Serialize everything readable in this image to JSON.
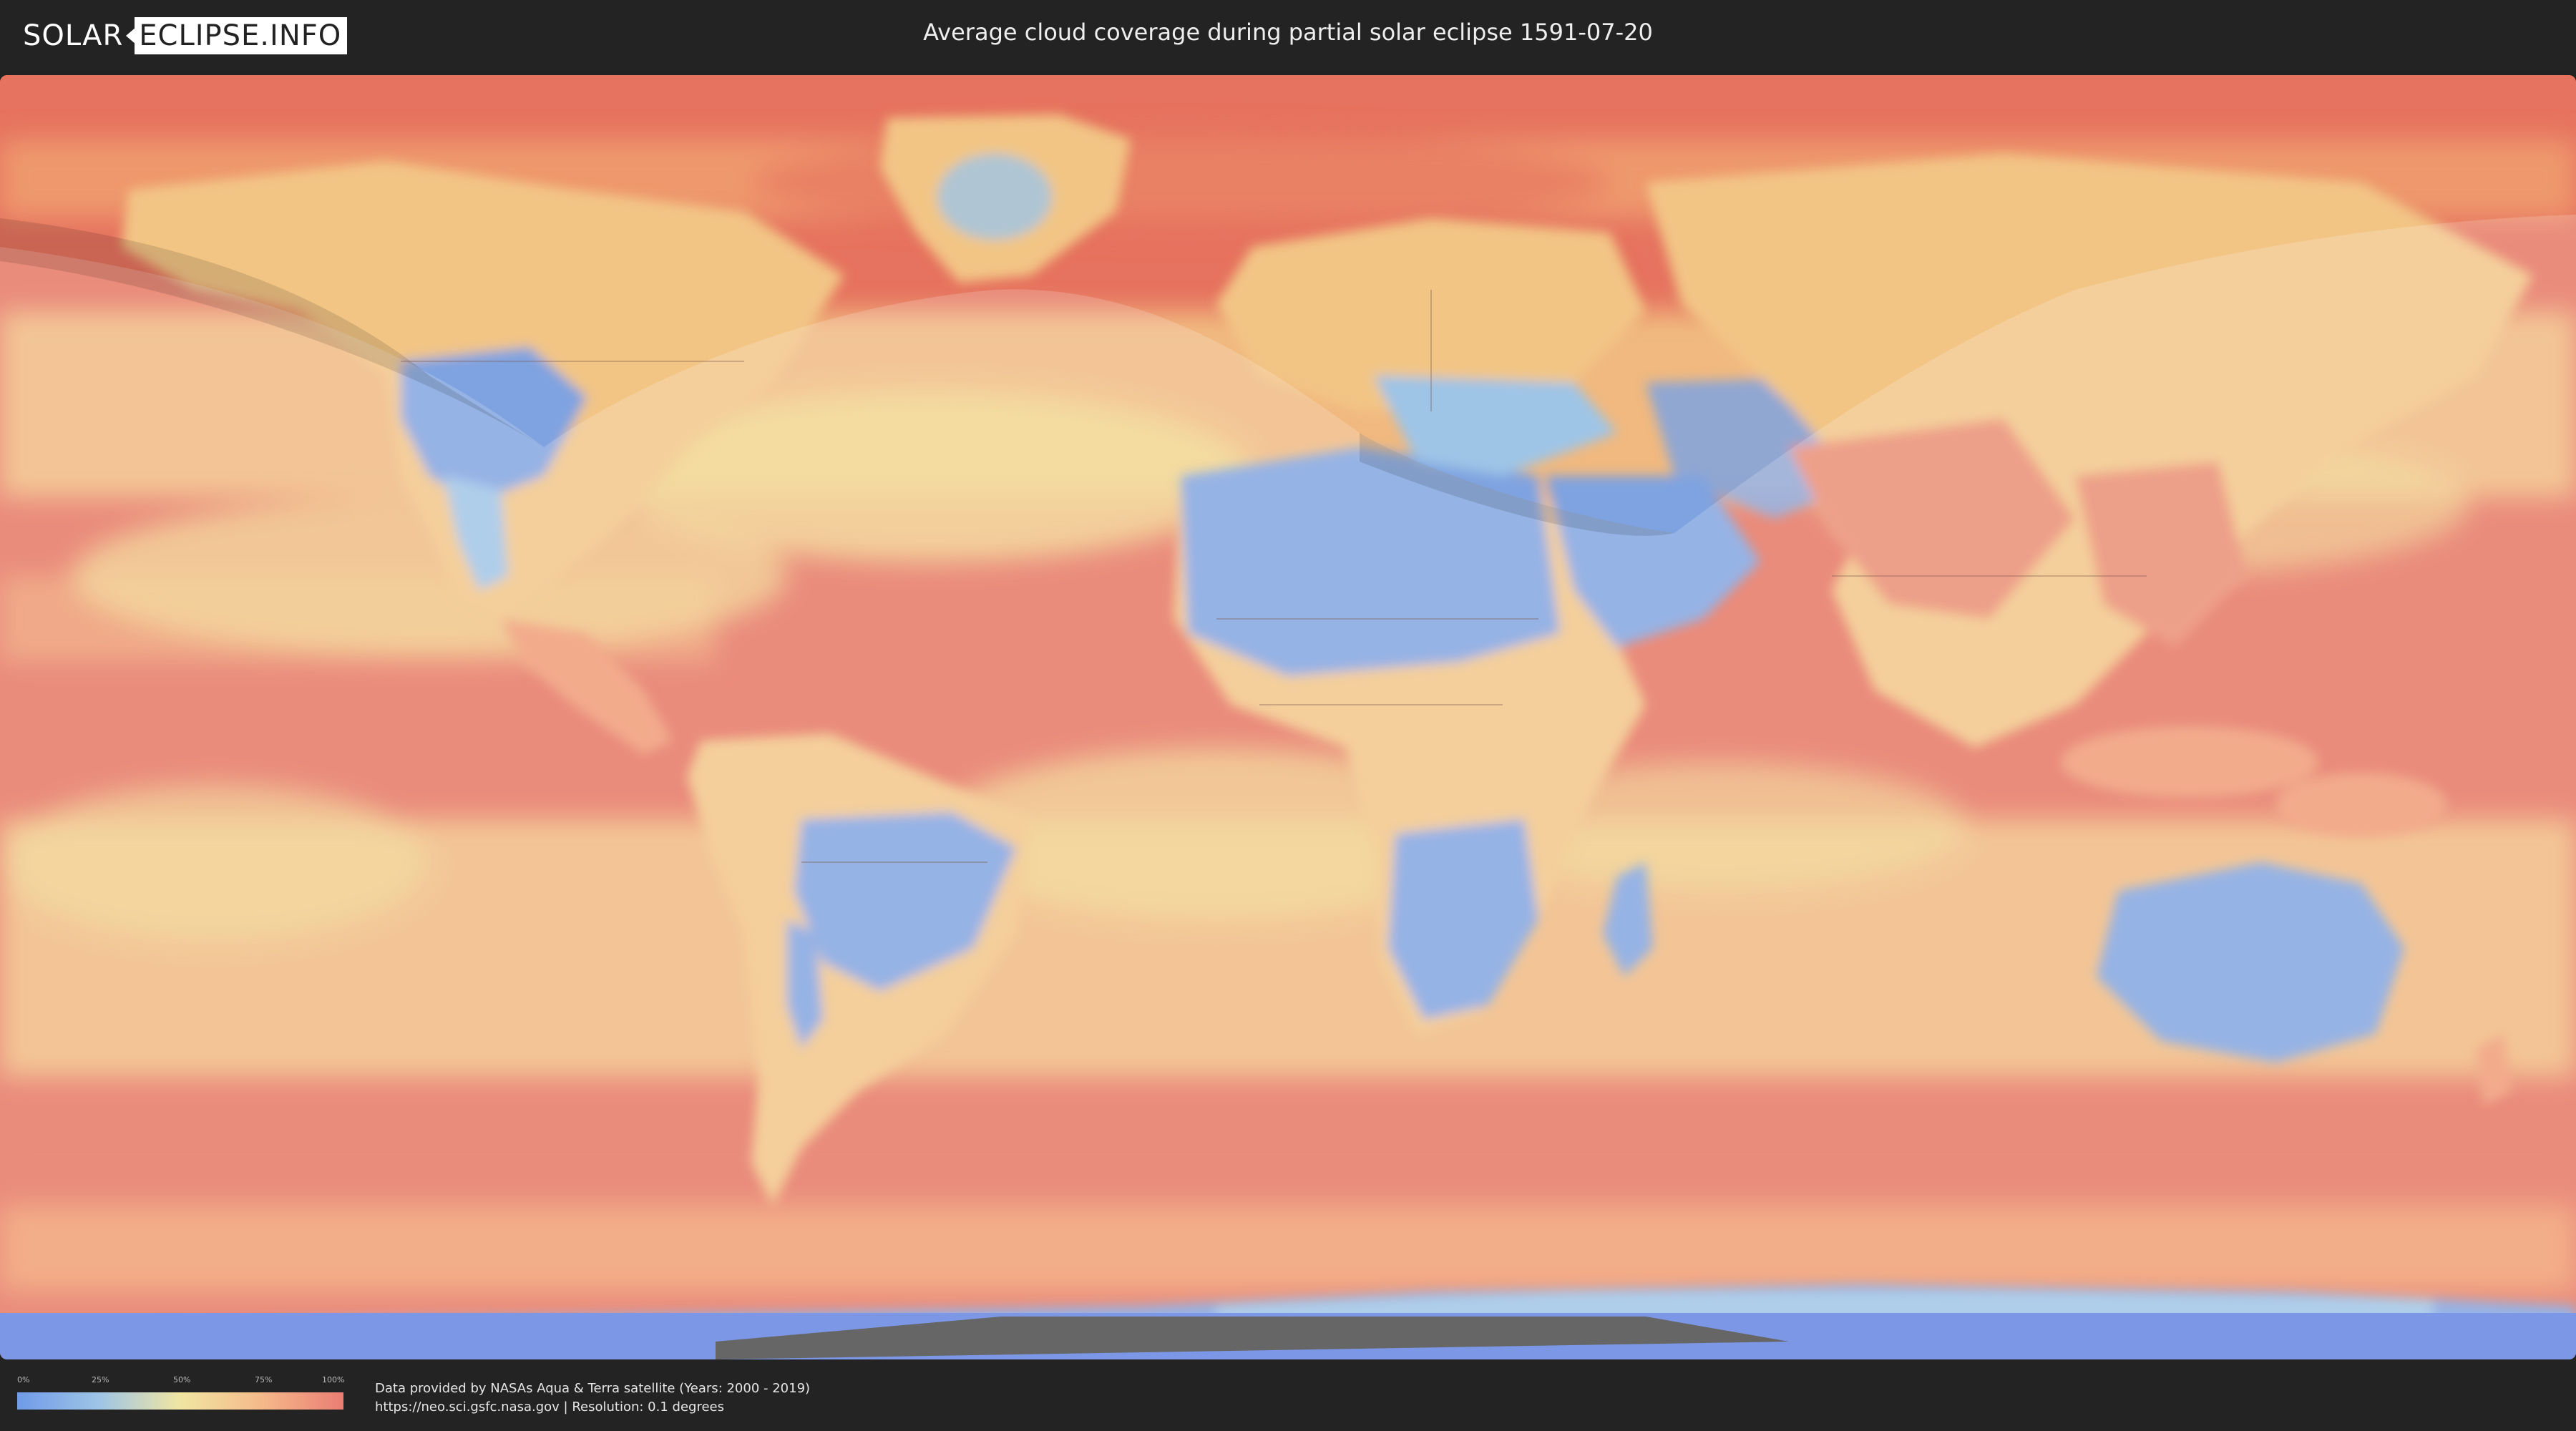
{
  "header": {
    "logo_left": "SOLAR",
    "logo_right": "ECLIPSE.INFO",
    "title": "Average cloud coverage during partial solar eclipse 1591-07-20"
  },
  "legend": {
    "ticks": [
      "0%",
      "25%",
      "50%",
      "75%",
      "100%"
    ],
    "colors": [
      "#6f9be8",
      "#9ec4e6",
      "#f1e6a2",
      "#f5b98a",
      "#ea7d73"
    ]
  },
  "footer": {
    "credit_line1": "Data provided by NASAs Aqua & Terra satellite (Years: 2000 - 2019)",
    "credit_line2": "https://neo.sci.gsfc.nasa.gov | Resolution: 0.1 degrees"
  },
  "map": {
    "palette": {
      "ocean_cloudy": "#e6735f",
      "ocean_mid": "#f2a873",
      "pale": "#f2d98f",
      "clear_blue": "#7fa3e0",
      "very_clear": "#5f80e0",
      "overlay": "#ffffff"
    }
  }
}
